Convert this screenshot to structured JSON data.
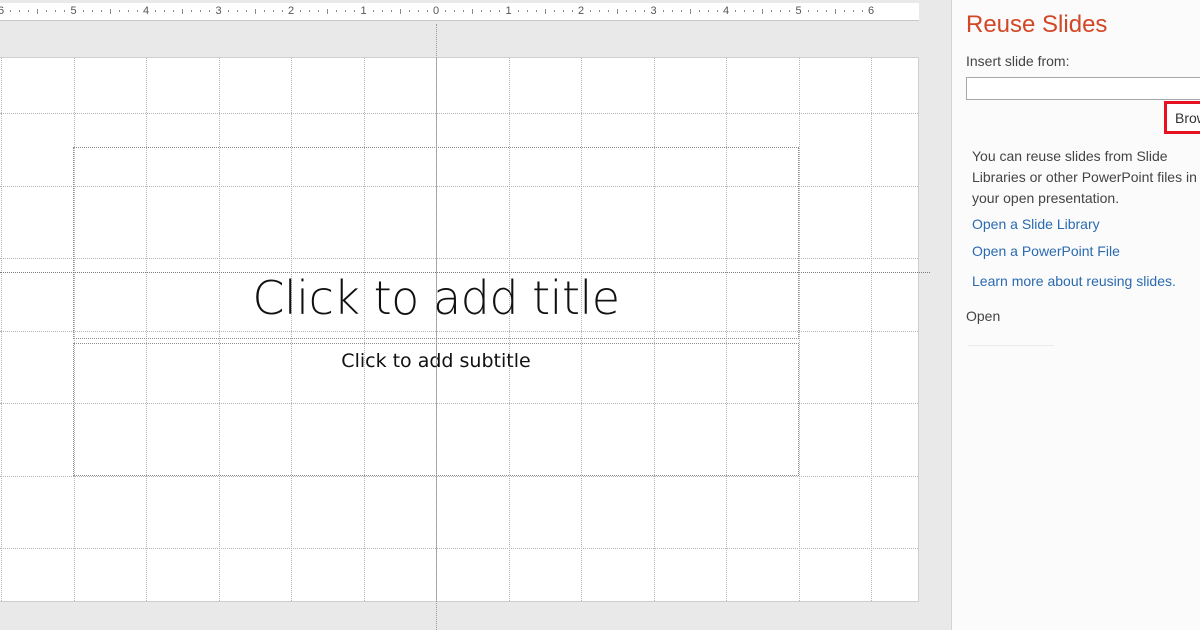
{
  "ruler": {
    "labels": [
      "6",
      "5",
      "4",
      "3",
      "2",
      "1",
      "0",
      "1",
      "2",
      "3",
      "4",
      "5",
      "6"
    ]
  },
  "slide": {
    "title_placeholder": "Click to add title",
    "subtitle_placeholder": "Click to add subtitle"
  },
  "task_pane": {
    "title": "Reuse Slides",
    "insert_label": "Insert slide from:",
    "input_value": "",
    "browse_label": "Browse",
    "info_text": "You can reuse slides from Slide Libraries or other PowerPoint files in your open presentation.",
    "links": {
      "open_library": "Open a Slide Library",
      "open_file": "Open a PowerPoint File",
      "learn_more": "Learn more about reusing slides."
    },
    "open_label": "Open"
  },
  "colors": {
    "pane_title": "#d24726",
    "link": "#2a6ab1",
    "browse_highlight": "#e81123"
  }
}
